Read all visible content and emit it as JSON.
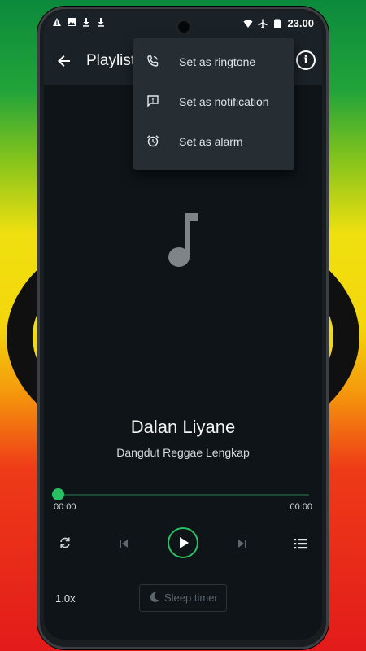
{
  "status_bar": {
    "time": "23.00",
    "left_icons": [
      "warning-icon",
      "image-icon",
      "download-icon",
      "download-icon"
    ],
    "right_icons": [
      "wifi-icon",
      "airplane-icon",
      "battery-icon"
    ]
  },
  "app_bar": {
    "title": "Playlist (",
    "back_icon": "arrow-back-icon",
    "info_label": "i"
  },
  "menu": {
    "items": [
      {
        "label": "Set as ringtone",
        "icon": "phone-ring-icon"
      },
      {
        "label": "Set as notification",
        "icon": "notification-icon"
      },
      {
        "label": "Set as alarm",
        "icon": "alarm-icon"
      }
    ]
  },
  "track": {
    "title": "Dalan Liyane",
    "artist": "Dangdut Reggae Lengkap",
    "elapsed": "00:00",
    "duration": "00:00",
    "progress": 0
  },
  "controls": {
    "repeat_icon": "repeat-icon",
    "previous_icon": "skip-previous-icon",
    "play_icon": "play-icon",
    "next_icon": "skip-next-icon",
    "queue_icon": "queue-list-icon",
    "speed": "1.0x",
    "sleep_timer": "Sleep timer"
  },
  "colors": {
    "accent": "#28c062",
    "background": "#0e1418",
    "appbar": "#1b2227",
    "menu": "#262d33"
  }
}
